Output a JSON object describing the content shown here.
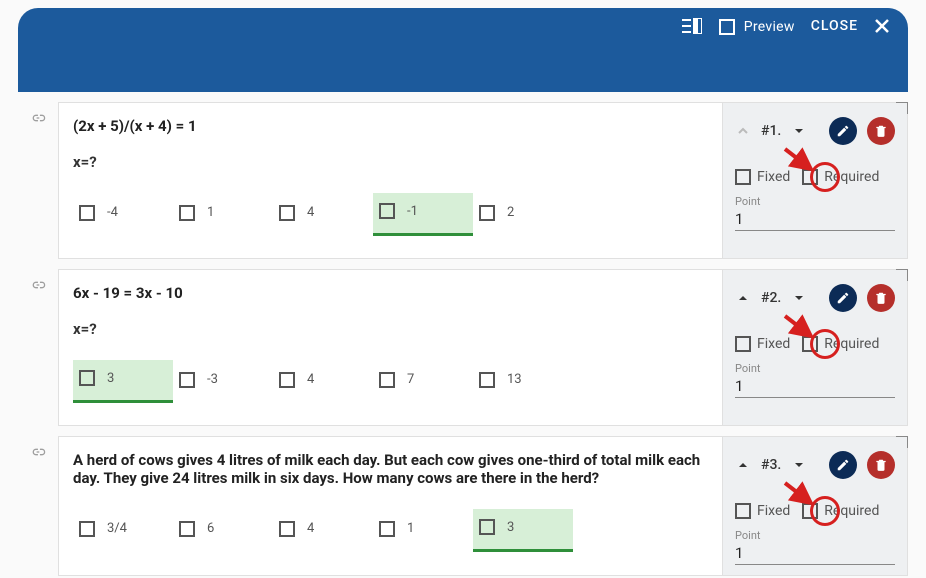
{
  "titlebar": {
    "preview": "Preview",
    "close": "CLOSE"
  },
  "labels": {
    "fixed": "Fixed",
    "required": "Required",
    "point": "Point"
  },
  "questions": [
    {
      "title": "(2x + 5)/(x + 4) = 1",
      "sub": "x=?",
      "num": "#1.",
      "point": "1",
      "arrow_up_muted": true,
      "options": [
        {
          "v": "-4",
          "correct": false
        },
        {
          "v": "1",
          "correct": false
        },
        {
          "v": "4",
          "correct": false
        },
        {
          "v": "-1",
          "correct": true
        },
        {
          "v": "2",
          "correct": false
        }
      ]
    },
    {
      "title": "6x - 19 = 3x - 10",
      "sub": "x=?",
      "num": "#2.",
      "point": "1",
      "arrow_up_muted": false,
      "options": [
        {
          "v": "3",
          "correct": true
        },
        {
          "v": "-3",
          "correct": false
        },
        {
          "v": "4",
          "correct": false
        },
        {
          "v": "7",
          "correct": false
        },
        {
          "v": "13",
          "correct": false
        }
      ]
    },
    {
      "title": "A herd of cows gives 4 litres of milk each day. But each cow gives one-third of total milk each day. They give 24 litres milk in six days. How many cows are there in the herd?",
      "sub": "",
      "num": "#3.",
      "point": "1",
      "arrow_up_muted": false,
      "options": [
        {
          "v": "3/4",
          "correct": false
        },
        {
          "v": "6",
          "correct": false
        },
        {
          "v": "4",
          "correct": false
        },
        {
          "v": "1",
          "correct": false
        },
        {
          "v": "3",
          "correct": true
        }
      ]
    }
  ]
}
